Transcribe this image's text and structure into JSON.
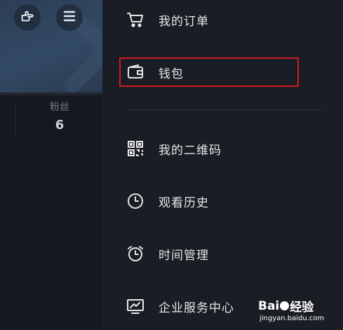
{
  "profile": {
    "fans_label": "粉丝",
    "fans_count": "6"
  },
  "menu": {
    "items": [
      {
        "label": "我的订单",
        "icon": "cart-icon"
      },
      {
        "label": "钱包",
        "icon": "wallet-icon"
      },
      {
        "label": "我的二维码",
        "icon": "qrcode-icon"
      },
      {
        "label": "观看历史",
        "icon": "clock-icon"
      },
      {
        "label": "时间管理",
        "icon": "alarm-clock-icon"
      },
      {
        "label": "企业服务中心",
        "icon": "monitor-chart-icon"
      }
    ]
  },
  "watermark": {
    "brand_prefix": "Bai",
    "brand_suffix": "经验",
    "url": "jingyan.baidu.com"
  },
  "colors": {
    "background": "#1b1d25",
    "highlight": "#d01c23",
    "text": "#e6e7ea"
  }
}
